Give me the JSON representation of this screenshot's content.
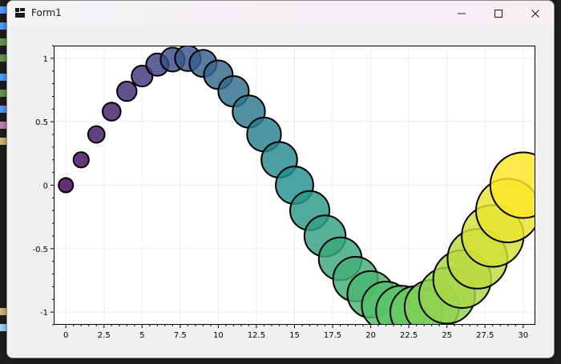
{
  "window": {
    "title": "Form1"
  },
  "colors": {
    "plot_background": "#ffffff",
    "grid": "#ececec",
    "marker_edge": "#000000",
    "colormap": "viridis"
  },
  "icons": {
    "app": "form-window-icon",
    "minimize": "minimize-icon",
    "maximize": "maximize-icon",
    "close": "close-icon"
  },
  "chart_data": {
    "type": "scatter",
    "title": "",
    "xlabel": "",
    "ylabel": "",
    "xlim": [
      -0.8,
      30.8
    ],
    "ylim": [
      -1.1,
      1.1
    ],
    "x_ticks": [
      0,
      2.5,
      5,
      7.5,
      10,
      12.5,
      15,
      17.5,
      20,
      22.5,
      25,
      27.5,
      30
    ],
    "x_tick_labels": [
      "0",
      "2.5",
      "5",
      "7.5",
      "10",
      "12.5",
      "15",
      "17.5",
      "20",
      "22.5",
      "25",
      "27.5",
      "30"
    ],
    "y_ticks": [
      -1,
      -0.5,
      0,
      0.5,
      1
    ],
    "y_tick_labels": [
      "-1",
      "-0.5",
      "0",
      "0.5",
      "1"
    ],
    "grid": true,
    "marker_size_grows_with_x": true,
    "color_mapped_to_x": true,
    "x": [
      0,
      1,
      2,
      3,
      4,
      5,
      6,
      7,
      8,
      9,
      10,
      11,
      12,
      13,
      14,
      15,
      16,
      17,
      18,
      19,
      20,
      21,
      22,
      23,
      24,
      25,
      26,
      27,
      28,
      29,
      30
    ],
    "y": [
      0,
      0.2,
      0.4,
      0.58,
      0.74,
      0.86,
      0.95,
      0.99,
      1.0,
      0.96,
      0.87,
      0.74,
      0.58,
      0.4,
      0.2,
      0,
      -0.2,
      -0.4,
      -0.58,
      -0.74,
      -0.86,
      -0.95,
      -0.99,
      -1.0,
      -0.96,
      -0.87,
      -0.74,
      -0.58,
      -0.4,
      -0.2,
      0
    ]
  }
}
